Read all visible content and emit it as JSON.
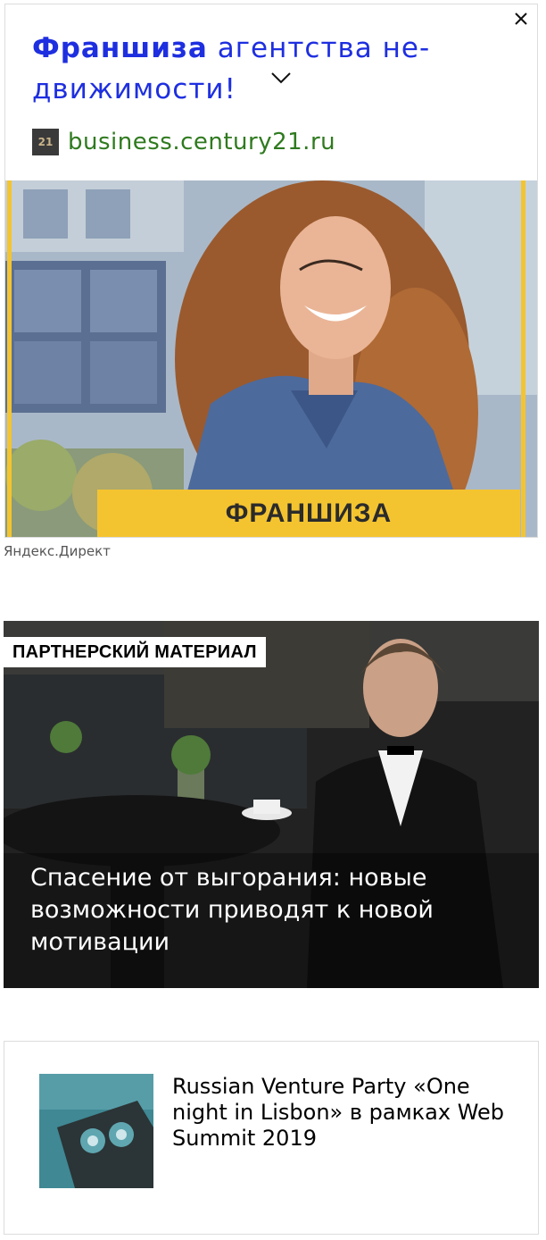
{
  "ad": {
    "title_bold": "Франшиза",
    "title_rest": " агентства не­движимости!",
    "favicon_text": "21",
    "domain": "business.century21.ru",
    "banner_text": "ФРАНШИЗА",
    "label": "Яндекс.Директ",
    "icons": {
      "close": "close-icon",
      "expand": "chevron-down-icon"
    },
    "colors": {
      "title": "#1e2fe0",
      "domain": "#2f7a1f",
      "banner": "#f4c430"
    }
  },
  "partner": {
    "badge": "ПАРТНЕРСКИЙ МАТЕРИАЛ",
    "headline": "Спасение от выгорания: новые возможности приводят к новой мотивации"
  },
  "related": {
    "title": "Russian Venture Party «One night in Lisbon» в рамках Web Summit 2019"
  }
}
